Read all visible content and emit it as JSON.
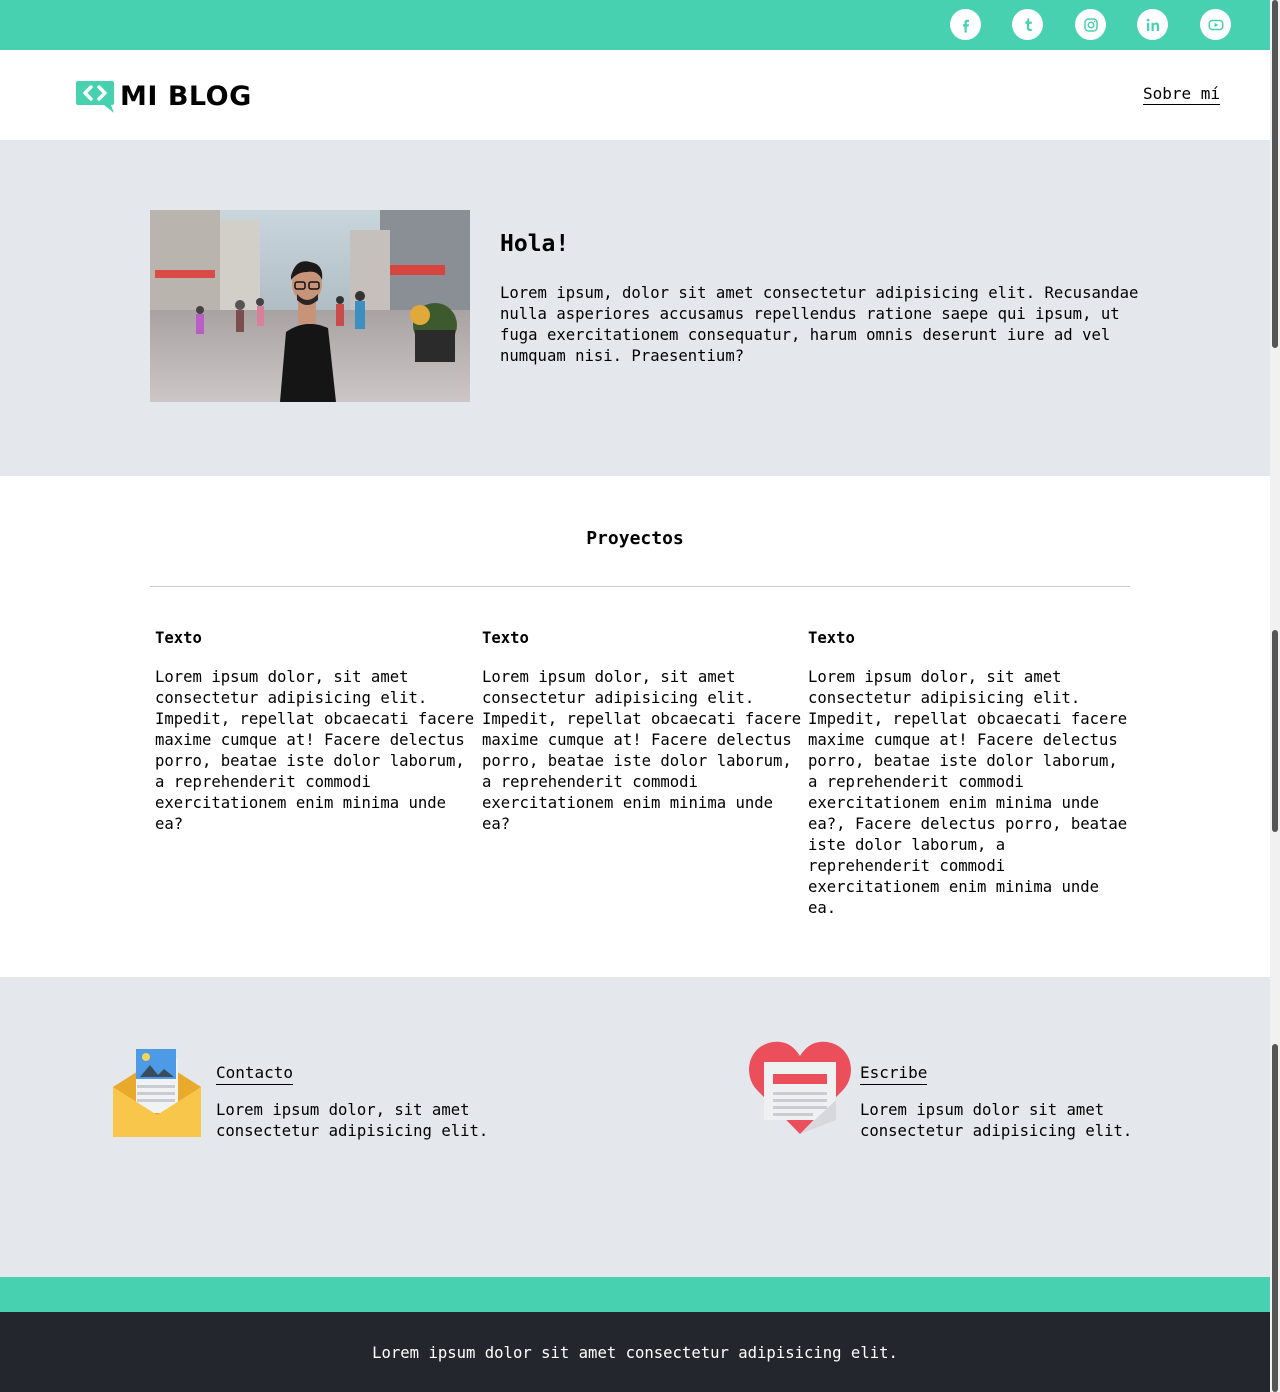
{
  "topbar": {
    "social": [
      {
        "name": "facebook-icon"
      },
      {
        "name": "tumblr-icon"
      },
      {
        "name": "instagram-icon"
      },
      {
        "name": "linkedin-icon"
      },
      {
        "name": "youtube-icon"
      }
    ],
    "color": "#48d1b0"
  },
  "header": {
    "logo_text": "MI BLOG",
    "nav_link": "Sobre mí"
  },
  "hero": {
    "title": "Hola!",
    "text": "Lorem ipsum, dolor sit amet consectetur adipisicing elit. Recusandae nulla asperiores accusamus repellendus ratione saepe qui ipsum, ut fuga exercitationem consequatur, harum omnis deserunt iure ad vel numquam nisi. Praesentium?",
    "photo_icon": "person-street-photo"
  },
  "projects": {
    "title": "Proyectos",
    "items": [
      {
        "title": "Texto",
        "text": "Lorem ipsum dolor, sit amet consectetur adipisicing elit. Impedit, repellat obcaecati facere maxime cumque at! Facere delectus porro, beatae iste dolor laborum, a reprehenderit commodi exercitationem enim minima unde ea?"
      },
      {
        "title": "Texto",
        "text": "Lorem ipsum dolor, sit amet consectetur adipisicing elit. Impedit, repellat obcaecati facere maxime cumque at! Facere delectus porro, beatae iste dolor laborum, a reprehenderit commodi exercitationem enim minima unde ea?"
      },
      {
        "title": "Texto",
        "text": "Lorem ipsum dolor, sit amet consectetur adipisicing elit. Impedit, repellat obcaecati facere maxime cumque at! Facere delectus porro, beatae iste dolor laborum, a reprehenderit commodi exercitationem enim minima unde ea?, Facere delectus porro, beatae iste dolor laborum, a reprehenderit commodi exercitationem enim minima unde ea."
      }
    ]
  },
  "contact": {
    "cards": [
      {
        "link": "Contacto",
        "text": "Lorem ipsum dolor, sit amet consectetur adipisicing elit.",
        "icon": "envelope-icon"
      },
      {
        "link": "Escribe",
        "text": "Lorem ipsum dolor sit amet consectetur adipisicing elit.",
        "icon": "heart-newspaper-icon"
      }
    ]
  },
  "footer": {
    "text": "Lorem ipsum dolor sit amet consectetur adipisicing elit."
  }
}
